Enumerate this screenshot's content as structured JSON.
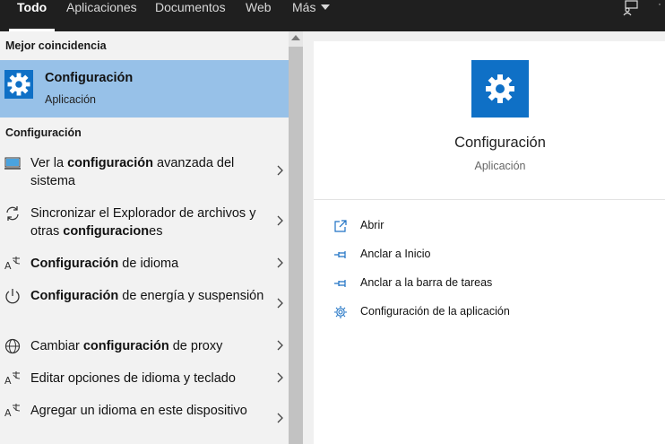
{
  "tabs": [
    {
      "label": "Todo",
      "active": true
    },
    {
      "label": "Aplicaciones",
      "active": false
    },
    {
      "label": "Documentos",
      "active": false
    },
    {
      "label": "Web",
      "active": false
    },
    {
      "label": "Más",
      "active": false
    }
  ],
  "icons": {
    "feedback": "feedback-icon",
    "more": "more-options-icon"
  },
  "left": {
    "best_match_header": "Mejor coincidencia",
    "best_match": {
      "title": "Configuración",
      "subtitle": "Aplicación",
      "icon": "gear-icon"
    },
    "settings_header": "Configuración",
    "items": [
      {
        "icon": "monitor-icon",
        "pre": "Ver la ",
        "bold": "configuración",
        "post": " avanzada del sistema"
      },
      {
        "icon": "sync-icon",
        "pre": "Sincronizar el Explorador de archivos y otras ",
        "bold": "configuracion",
        "post": "es"
      },
      {
        "icon": "language-icon",
        "pre": "",
        "bold": "Configuración",
        "post": " de idioma"
      },
      {
        "icon": "power-icon",
        "pre": "",
        "bold": "Configuración",
        "post": " de energía y suspensión"
      },
      {
        "icon": "globe-icon",
        "pre": "Cambiar ",
        "bold": "configuración",
        "post": " de proxy"
      },
      {
        "icon": "language-icon",
        "pre": "Editar opciones de idioma y teclado",
        "bold": "",
        "post": ""
      },
      {
        "icon": "language-icon",
        "pre": "Agregar un idioma en este dispositivo",
        "bold": "",
        "post": ""
      }
    ]
  },
  "right": {
    "app_title": "Configuración",
    "app_subtitle": "Aplicación",
    "actions": [
      {
        "icon": "open-icon",
        "label": "Abrir"
      },
      {
        "icon": "pin-icon",
        "label": "Anclar a Inicio"
      },
      {
        "icon": "pin-icon",
        "label": "Anclar a la barra de tareas"
      },
      {
        "icon": "gear-icon",
        "label": "Configuración de la aplicación"
      }
    ]
  },
  "colors": {
    "topbar": "#1f1f1f",
    "selected": "#97c1e8",
    "accent": "#0f70c6"
  }
}
